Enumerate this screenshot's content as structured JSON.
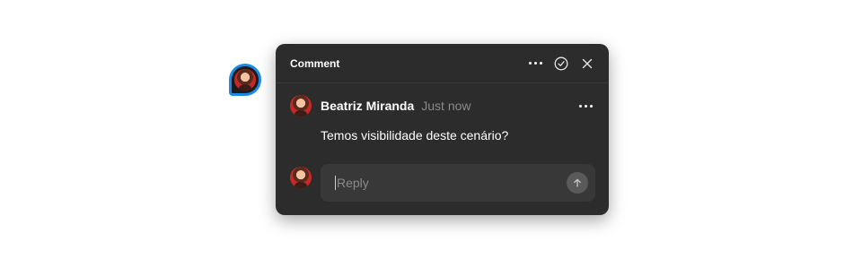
{
  "comment_panel": {
    "title": "Comment",
    "more_icon": "more-horizontal-icon",
    "resolve_icon": "check-circle-icon",
    "close_icon": "close-icon"
  },
  "comment": {
    "author": "Beatriz Miranda",
    "timestamp": "Just now",
    "text": "Temos visibilidade deste cenário?",
    "more_icon": "more-horizontal-icon"
  },
  "reply": {
    "placeholder": "Reply",
    "value": "",
    "send_icon": "arrow-up-icon"
  },
  "colors": {
    "panel_bg": "#2c2c2c",
    "reply_bg": "#383838",
    "pin_border": "#1e88e5",
    "muted_text": "#8a8a8a"
  }
}
